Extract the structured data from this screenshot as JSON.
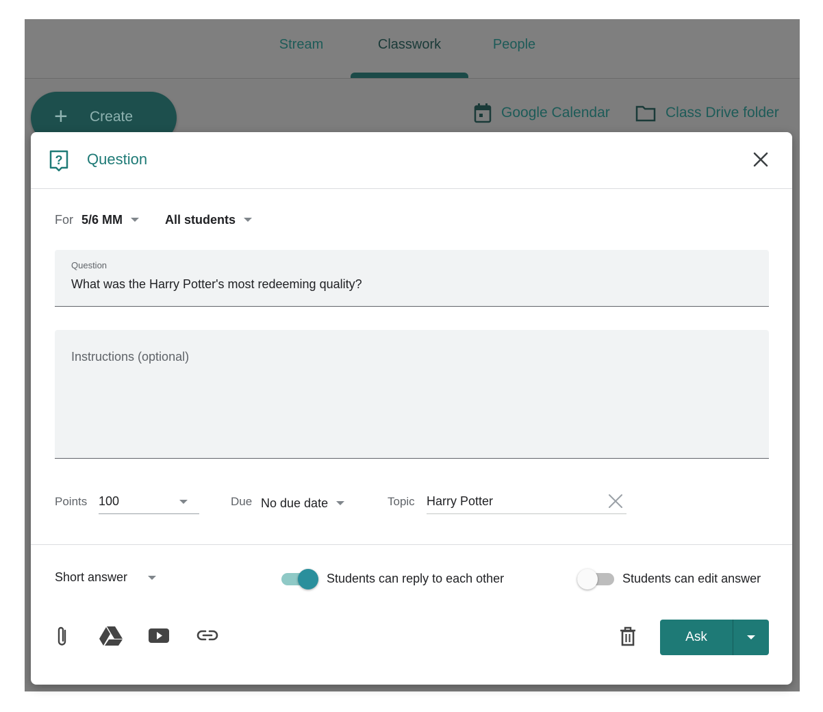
{
  "tabs": [
    {
      "label": "Stream",
      "active": false
    },
    {
      "label": "Classwork",
      "active": true
    },
    {
      "label": "People",
      "active": false
    }
  ],
  "toolbar": {
    "create_label": "Create",
    "calendar_label": "Google Calendar",
    "drive_label": "Class Drive folder"
  },
  "dialog": {
    "title": "Question",
    "for_label": "For",
    "class_value": "5/6 MM",
    "audience_value": "All students",
    "question_label": "Question",
    "question_value": "What was the Harry Potter's most redeeming quality?",
    "instructions_placeholder": "Instructions (optional)",
    "points_label": "Points",
    "points_value": "100",
    "due_label": "Due",
    "due_value": "No due date",
    "topic_label": "Topic",
    "topic_value": "Harry Potter",
    "answer_type": "Short answer",
    "reply_toggle": {
      "label": "Students can reply to each other",
      "on": true
    },
    "edit_toggle": {
      "label": "Students can edit answer",
      "on": false
    },
    "ask_label": "Ask"
  },
  "colors": {
    "accent": "#1e7a76",
    "toggle_on_track": "#8fc9c6",
    "toggle_on_knob": "#2a8f9c",
    "overlay": "#7d7d7d"
  },
  "icons": [
    "calendar-icon",
    "folder-icon",
    "question-icon",
    "close-icon",
    "attach-icon",
    "drive-icon",
    "youtube-icon",
    "link-icon",
    "trash-icon",
    "dropdown-arrow-icon"
  ]
}
